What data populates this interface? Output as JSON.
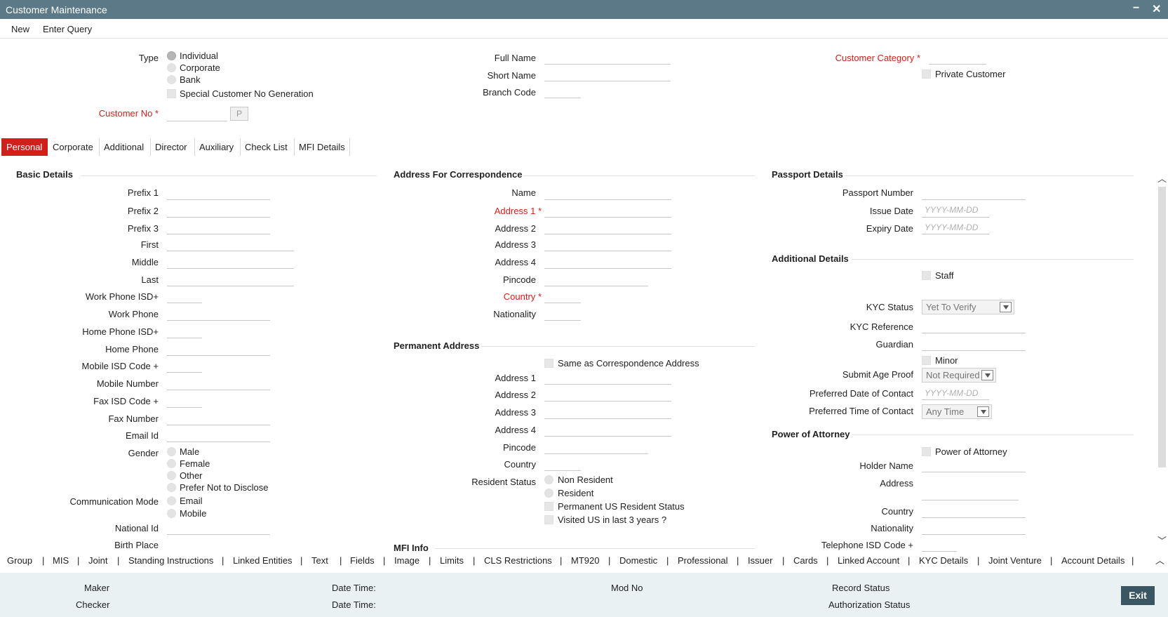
{
  "window": {
    "title": "Customer Maintenance",
    "minimize": "−",
    "close": "✕"
  },
  "menu": {
    "new": "New",
    "enter_query": "Enter Query"
  },
  "header": {
    "type_label": "Type",
    "type_options": [
      "Individual",
      "Corporate",
      "Bank"
    ],
    "special_customer": "Special Customer No Generation",
    "customer_no_label": "Customer No",
    "req_mark": "*",
    "p_button": "P",
    "full_name_label": "Full Name",
    "short_name_label": "Short Name",
    "branch_code_label": "Branch Code",
    "customer_category_label": "Customer Category",
    "private_customer": "Private Customer"
  },
  "tabs": [
    "Personal",
    "Corporate",
    "Additional",
    "Director",
    "Auxiliary",
    "Check List",
    "MFI Details"
  ],
  "basic": {
    "heading": "Basic Details",
    "prefix1": "Prefix 1",
    "prefix2": "Prefix 2",
    "prefix3": "Prefix 3",
    "first": "First",
    "middle": "Middle",
    "last": "Last",
    "work_isd": "Work Phone ISD+",
    "work_phone": "Work Phone",
    "home_isd": "Home Phone ISD+",
    "home_phone": "Home Phone",
    "mobile_isd": "Mobile ISD Code +",
    "mobile_number": "Mobile Number",
    "fax_isd": "Fax ISD Code +",
    "fax_number": "Fax Number",
    "email_id": "Email Id",
    "gender": "Gender",
    "gender_options": [
      "Male",
      "Female",
      "Other",
      "Prefer Not to Disclose"
    ],
    "comm_mode": "Communication Mode",
    "comm_options": [
      "Email",
      "Mobile"
    ],
    "national_id": "National Id",
    "birth_place": "Birth Place"
  },
  "corr": {
    "heading": "Address For Correspondence",
    "name": "Name",
    "address1": "Address 1",
    "address2": "Address 2",
    "address3": "Address 3",
    "address4": "Address 4",
    "pincode": "Pincode",
    "country": "Country",
    "nationality": "Nationality"
  },
  "perm": {
    "heading": "Permanent Address",
    "same_as": "Same as Correspondence Address",
    "address1": "Address 1",
    "address2": "Address 2",
    "address3": "Address 3",
    "address4": "Address 4",
    "pincode": "Pincode",
    "country": "Country",
    "resident_status": "Resident Status",
    "resident_options": [
      "Non Resident",
      "Resident"
    ],
    "perm_us": "Permanent US Resident Status",
    "visited_us": "Visited US in last 3 years ?"
  },
  "mfi": {
    "heading": "MFI Info"
  },
  "passport": {
    "heading": "Passport Details",
    "number": "Passport Number",
    "issue_date": "Issue Date",
    "expiry_date": "Expiry Date",
    "date_placeholder": "YYYY-MM-DD"
  },
  "additional": {
    "heading": "Additional Details",
    "staff": "Staff",
    "kyc_status": "KYC Status",
    "kyc_status_value": "Yet To Verify",
    "kyc_reference": "KYC Reference",
    "guardian": "Guardian",
    "minor": "Minor",
    "submit_age_proof": "Submit Age Proof",
    "submit_age_value": "Not Required",
    "pref_date": "Preferred Date of Contact",
    "pref_date_ph": "YYYY-MM-DD",
    "pref_time": "Preferred Time of Contact",
    "pref_time_value": "Any Time"
  },
  "poa": {
    "heading": "Power of Attorney",
    "checkbox": "Power of Attorney",
    "holder_name": "Holder Name",
    "address": "Address",
    "country": "Country",
    "nationality": "Nationality",
    "telephone_isd": "Telephone ISD Code +"
  },
  "bottom_nav": [
    "Group",
    "MIS",
    "Joint",
    "Standing Instructions",
    "Linked Entities",
    "Text",
    "Fields",
    "Image",
    "Limits",
    "CLS Restrictions",
    "MT920",
    "Domestic",
    "Professional",
    "Issuer",
    "Cards",
    "Linked Account",
    "KYC Details",
    "Joint Venture",
    "Account Details"
  ],
  "footer": {
    "maker": "Maker",
    "checker": "Checker",
    "date_time": "Date Time:",
    "mod_no": "Mod No",
    "record_status": "Record Status",
    "auth_status": "Authorization Status",
    "exit": "Exit"
  }
}
